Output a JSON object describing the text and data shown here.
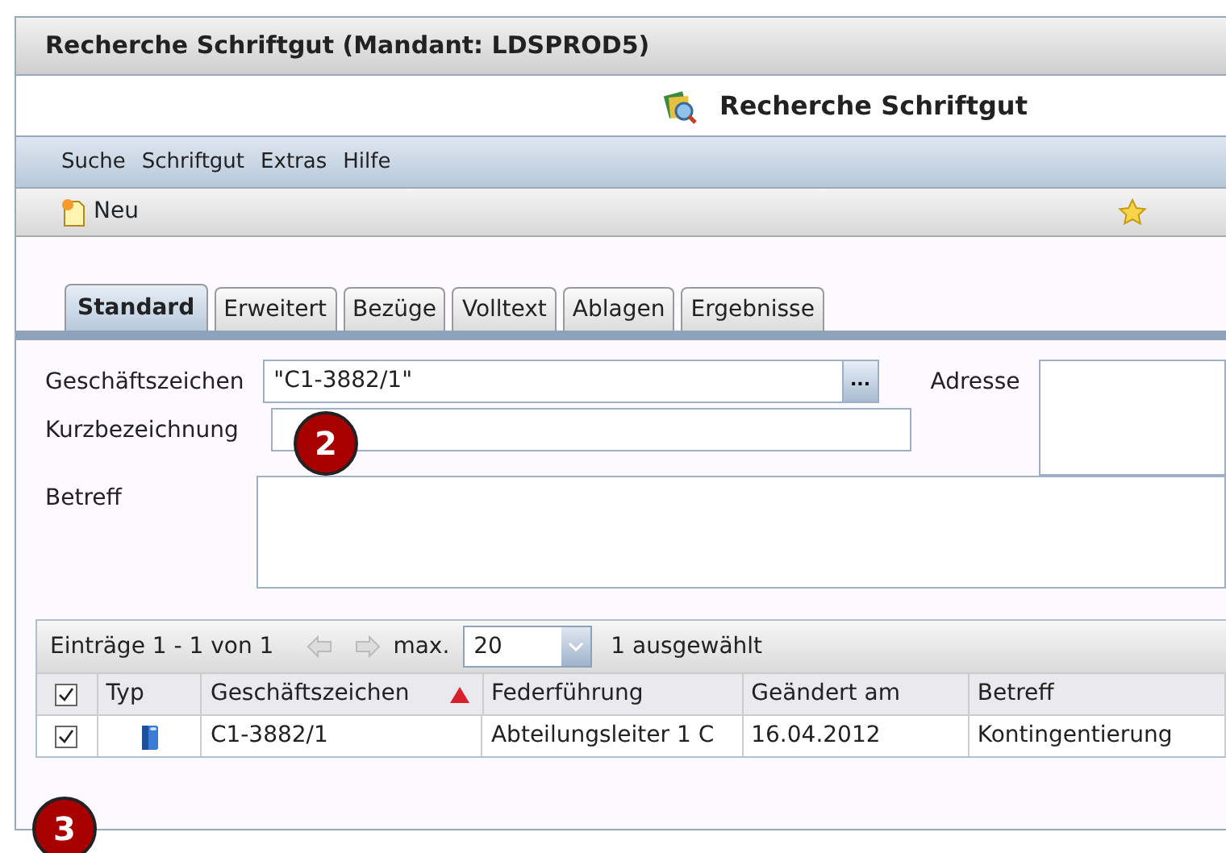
{
  "window": {
    "title": "Recherche Schriftgut (Mandant: LDSPROD5)"
  },
  "header": {
    "title": "Recherche Schriftgut"
  },
  "menu": [
    "Suche",
    "Schriftgut",
    "Extras",
    "Hilfe"
  ],
  "toolbar": {
    "buttons": [
      "Neu"
    ]
  },
  "tabs": [
    {
      "label": "Standard",
      "selected": true
    },
    {
      "label": "Erweitert",
      "selected": false
    },
    {
      "label": "Bezüge",
      "selected": false
    },
    {
      "label": "Volltext",
      "selected": false
    },
    {
      "label": "Ablagen",
      "selected": false
    },
    {
      "label": "Ergebnisse",
      "selected": false
    }
  ],
  "form": {
    "geschaeftszeichen": {
      "label": "Geschäftszeichen",
      "value": "\"C1-3882/1\"",
      "button": "..."
    },
    "kurzbezeichnung": {
      "label": "Kurzbezeichnung"
    },
    "adresse": {
      "label": "Adresse"
    },
    "betreff": {
      "label": "Betreff"
    }
  },
  "results": {
    "summary": "Einträge 1 - 1 von 1",
    "max_label": "max.",
    "max_value": "20",
    "selected_count": "1 ausgewählt",
    "all_checked": true,
    "columns": [
      {
        "label": "Typ",
        "sorted": false
      },
      {
        "label": "Geschäftszeichen",
        "sorted": true
      },
      {
        "label": "Federführung",
        "sorted": false
      },
      {
        "label": "Geändert am",
        "sorted": false
      },
      {
        "label": "Betreff",
        "sorted": false
      }
    ],
    "rows": [
      {
        "checked": true,
        "cells": [
          "",
          "C1-3882/1",
          "Abteilungsleiter 1 C",
          "16.04.2012",
          "Kontingentierung"
        ]
      }
    ]
  },
  "callouts": [
    "2",
    "3"
  ]
}
